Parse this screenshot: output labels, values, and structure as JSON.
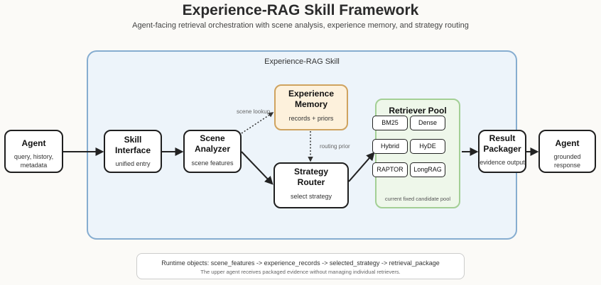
{
  "title": "Experience-RAG Skill Framework",
  "subtitle": "Agent-facing retrieval orchestration with scene analysis, experience memory, and strategy routing",
  "frame_title": "Experience-RAG Skill",
  "nodes": {
    "agent_in": {
      "title": "Agent",
      "sub": "query, history, metadata"
    },
    "skill_interface": {
      "title": "Skill Interface",
      "sub": "unified entry"
    },
    "scene_analyzer": {
      "title": "Scene Analyzer",
      "sub": "scene features"
    },
    "experience_memory": {
      "title": "Experience Memory",
      "sub": "records + priors"
    },
    "strategy_router": {
      "title": "Strategy Router",
      "sub": "select strategy"
    },
    "result_packager": {
      "title": "Result Packager",
      "sub": "evidence output"
    },
    "agent_out": {
      "title": "Agent",
      "sub": "grounded response"
    }
  },
  "retriever_pool": {
    "title": "Retriever Pool",
    "retrievers": [
      "BM25",
      "Dense",
      "Hybrid",
      "HyDE",
      "RAPTOR",
      "LongRAG"
    ],
    "note": "current fixed candidate pool"
  },
  "edge_labels": {
    "scene_lookup": "scene lookup",
    "routing_prior": "routing prior"
  },
  "runtime": {
    "line1": "Runtime objects: scene_features -> experience_records -> selected_strategy -> retrieval_package",
    "line2": "The upper agent receives packaged evidence without managing individual retrievers."
  }
}
